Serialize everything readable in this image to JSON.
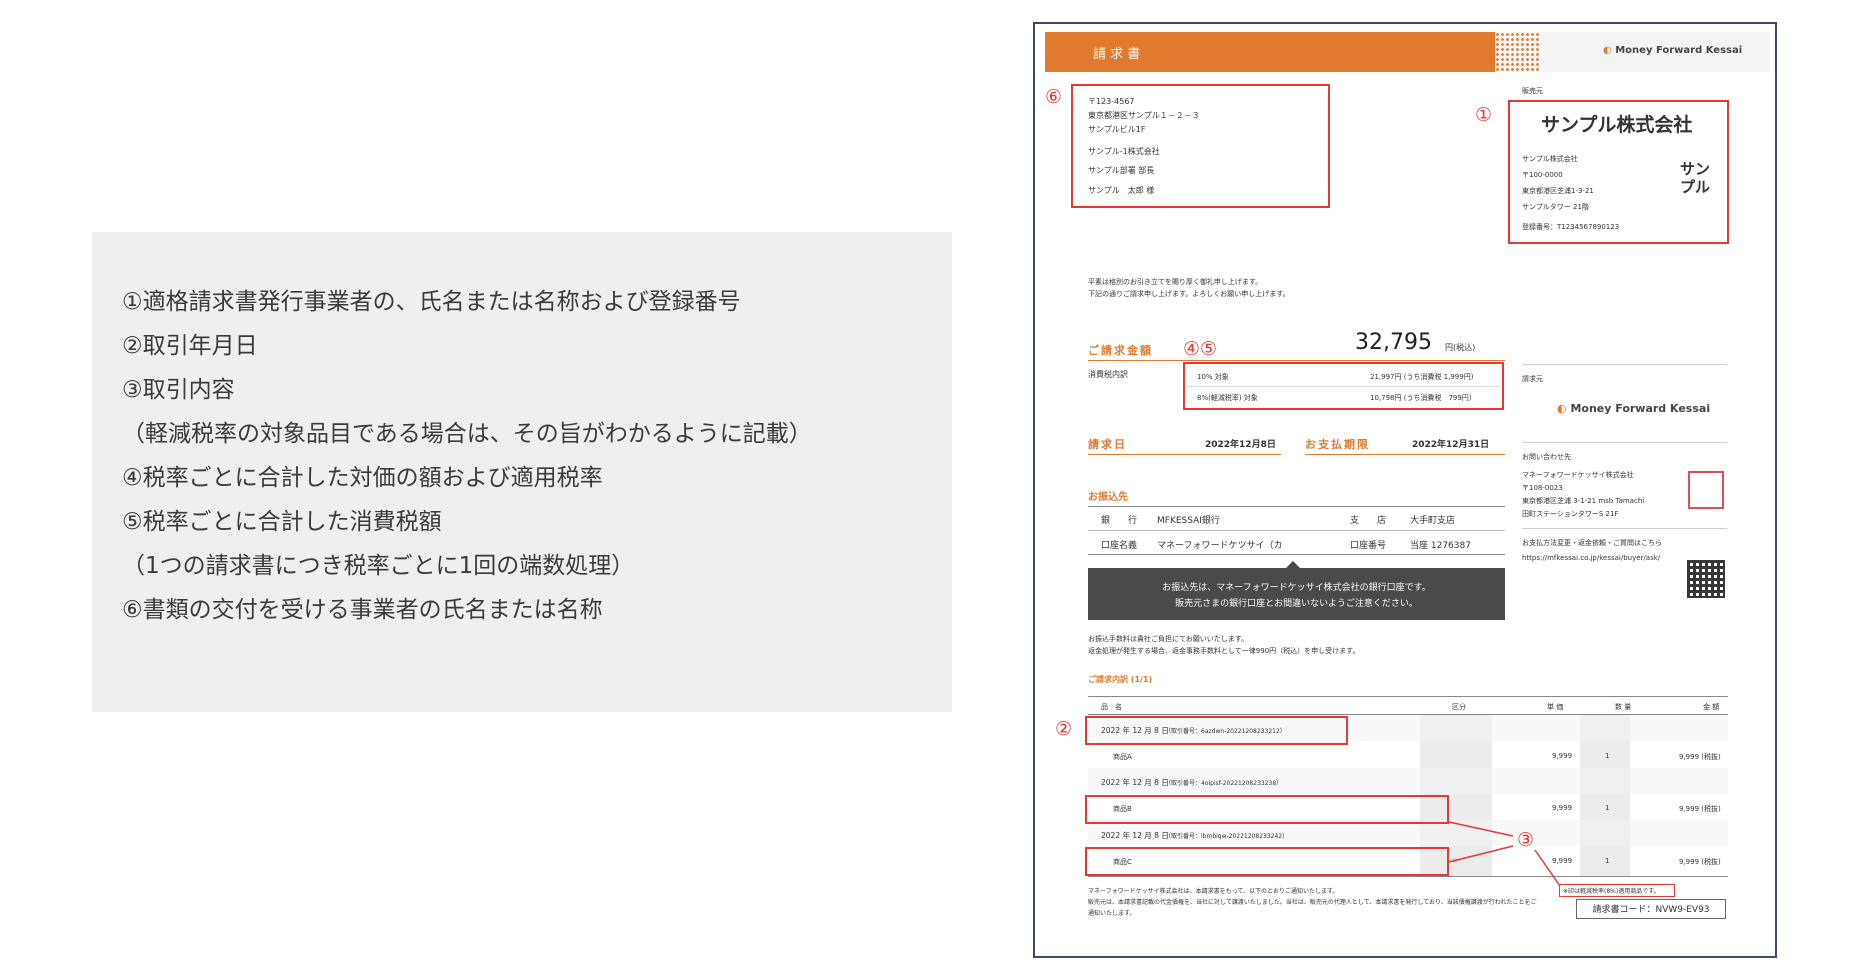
{
  "legend": {
    "lines": [
      "①適格請求書発行事業者の、氏名または名称および登録番号",
      "②取引年月日",
      "③取引内容",
      "（軽減税率の対象品目である場合は、その旨がわかるように記載）",
      "④税率ごとに合計した対価の額および適用税率",
      "⑤税率ごとに合計した消費税額",
      "（1つの請求書につき税率ごとに1回の端数処理）",
      "⑥書類の交付を受ける事業者の氏名または名称"
    ]
  },
  "invoice": {
    "header_title": "請 求 書",
    "brand": "Money Forward Kessai",
    "markers": {
      "m1": "①",
      "m2": "②",
      "m3": "③",
      "m45": "④⑤",
      "m6": "⑥"
    },
    "recipient": {
      "postal": "〒123-4567",
      "address": "東京都港区サンプル１－２－３",
      "building": "サンプルビル1F",
      "company": "サンプル-1株式会社",
      "dept": "サンプル部署 部長",
      "person": "サンプル　太郎 様"
    },
    "seller": {
      "section_label": "販売元",
      "name": "サンプル株式会社",
      "sub_name": "サンプル株式会社",
      "postal": "〒100-0000",
      "address": "東京都港区芝浦1-3-21",
      "building": "サンプルタワー 21階",
      "reg_no": "登録番号：T12345678901​23",
      "seal_line1": "サン",
      "seal_line2": "プル"
    },
    "greeting1": "平素は格別のお引き立てを賜り厚く御礼申し上げます。",
    "greeting2": "下記の通りご請求申し上げます。よろしくお願い申し上げます。",
    "amount_label": "ご請求金額",
    "amount_value": "32,795",
    "amount_unit": "円(税込)",
    "tax_breakdown_label": "消費税内訳",
    "tax_rows": [
      {
        "label": "10% 対象",
        "value": "21,997円 (うち消費税 1,999円)"
      },
      {
        "label": "8%(軽減税率) 対象",
        "value": "10,798円 (うち消費税　799円)"
      }
    ],
    "billing_date_label": "請求日",
    "billing_date": "2022年12月8日",
    "due_label": "お支払期限",
    "due_date": "2022年12月31日",
    "transfer_label": "お振込先",
    "bank_label": "銀　　行",
    "bank": "MFKESSAI銀行",
    "branch_label": "支　　店",
    "branch": "大手町支店",
    "acct_name_label": "口座名義",
    "acct_name": "マネーフォワードケツサイ（カ",
    "acct_no_label": "口座番号",
    "acct_no": "当座 1276387",
    "tooltip1": "お振込先は、マネーフォワードケッサイ株式会社の銀行口座です。",
    "tooltip2": "販売元さまの銀行口座とお間違いないようご注意ください。",
    "fee_note1": "お振込手数料は貴社ご負担にてお願いいたします。",
    "fee_note2": "返金処理が発生する場合、返金事務手数料として一律990円（税込）を申し受けます。",
    "billed_to_label": "請求元",
    "contact_label": "お問い合わせ先",
    "contact_company": "マネーフォワードケッサイ株式会社",
    "contact_postal": "〒108-0023",
    "contact_address": "東京都港区芝浦 3-1-21 msb Tamachi",
    "contact_building": "田町ステーションタワーS 21F",
    "payment_change": "お支払方法変更・返金依頼・ご質問はこちら",
    "payment_url": "https://mfkessai.co.jp/kessai/buyer/ask/",
    "details_label": "ご請求内訳 (1/1)",
    "columns": [
      "品　名",
      "区分",
      "単 価",
      "数 量",
      "金 額"
    ],
    "groups": [
      {
        "date": "2022 年 12 月 8 日",
        "txn": "（取引番号：6azdwn-20221208233212）",
        "item": "商品A",
        "kubun": "",
        "price": "9,999",
        "qty": "1",
        "amount": "9,999 (税抜)"
      },
      {
        "date": "2022 年 12 月 8 日",
        "txn": "（取引番号：4oipisf-20221208233238）",
        "item": "商品B",
        "kubun": "",
        "price": "9,999",
        "qty": "1",
        "amount": "9,999 (税抜)"
      },
      {
        "date": "2022 年 12 月 8 日",
        "txn": "（取引番号：ibmbiqw-20221208233242）",
        "item": "商品C",
        "kubun": "※",
        "price": "9,999",
        "qty": "1",
        "amount": "9,999 (税抜)"
      }
    ],
    "reduced_note": "※印は軽減税率(8%)適用商品です。",
    "footer1": "マネーフォワードケッサイ株式会社は、本請求書をもって、以下のとおりご通知いたします。",
    "footer2": "販売元は、本請求書記載の代金債権を、当社に対して譲渡いたしました。当社は、販売元の代理人として、本請求書を発行しており、当該債権譲渡が行われたことをご",
    "footer3": "通知いたします。",
    "invoice_code": "請求書コード：NVW9-EV93"
  }
}
